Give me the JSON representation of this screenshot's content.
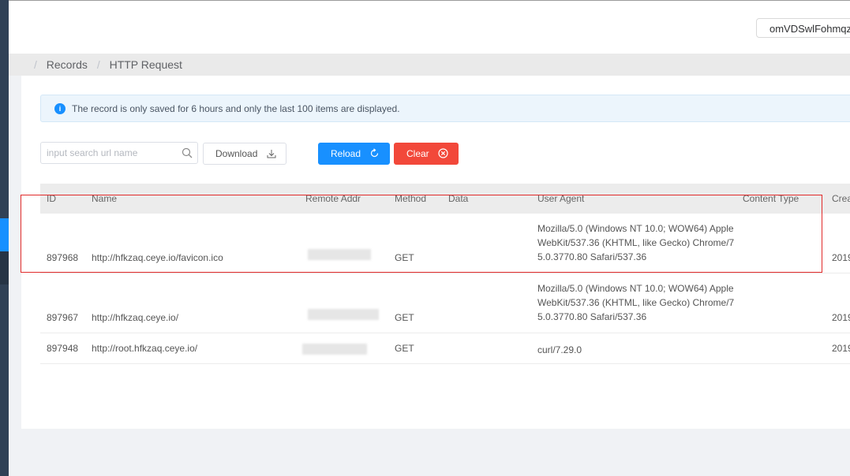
{
  "header": {
    "user": "omVDSwlFohmqzk"
  },
  "breadcrumb": {
    "items": [
      "Records",
      "HTTP Request"
    ]
  },
  "alert": {
    "icon": "info-icon",
    "message": "The record is only saved for 6 hours and only the last 100 items are displayed."
  },
  "toolbar": {
    "search_placeholder": "input search url name",
    "download_label": "Download",
    "reload_label": "Reload",
    "clear_label": "Clear"
  },
  "table": {
    "columns": [
      "ID",
      "Name",
      "Remote Addr",
      "Method",
      "Data",
      "User Agent",
      "Content Type",
      "Crea"
    ],
    "rows": [
      {
        "id": "897968",
        "name": "http://hfkzaq.ceye.io/favicon.ico",
        "remote_addr": "",
        "method": "GET",
        "data": "",
        "user_agent": "Mozilla/5.0 (Windows NT 10.0; WOW64) AppleWebKit/537.36 (KHTML, like Gecko) Chrome/75.0.3770.80 Safari/537.36",
        "content_type": "",
        "created": "2019"
      },
      {
        "id": "897967",
        "name": "http://hfkzaq.ceye.io/",
        "remote_addr": "",
        "method": "GET",
        "data": "",
        "user_agent": "Mozilla/5.0 (Windows NT 10.0; WOW64) AppleWebKit/537.36 (KHTML, like Gecko) Chrome/75.0.3770.80 Safari/537.36",
        "content_type": "",
        "created": "2019"
      },
      {
        "id": "897948",
        "name": "http://root.hfkzaq.ceye.io/",
        "remote_addr": "",
        "method": "GET",
        "data": "",
        "user_agent": "curl/7.29.0",
        "content_type": "",
        "created": "2019"
      }
    ]
  },
  "colors": {
    "primary": "#1890ff",
    "danger": "#f2483a",
    "highlight": "#e12b2b"
  }
}
